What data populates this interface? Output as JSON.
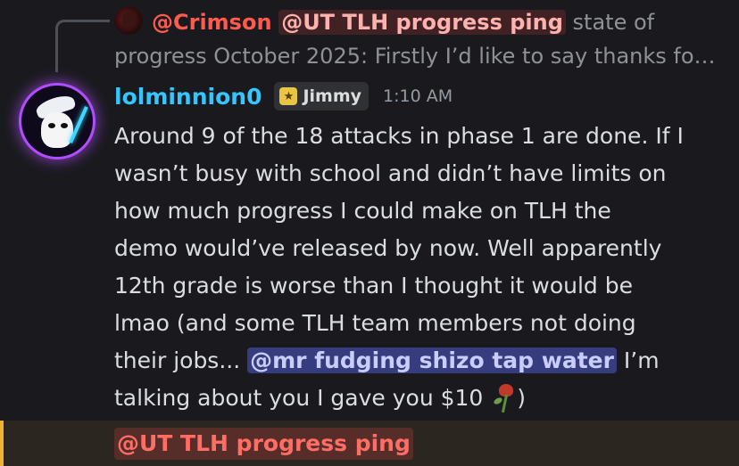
{
  "reply": {
    "author": "@Crimson",
    "mention": "@UT TLH progress ping",
    "excerpt_line1": "state of",
    "excerpt_line2": "progress October 2025:  Firstly I’d like to say thanks fo…"
  },
  "message": {
    "username": "lolminnion0",
    "tag": "Jimmy",
    "timestamp": "1:10 AM",
    "lines": [
      "Around 9 of the 18 attacks in phase 1 are done. If I",
      "wasn’t busy with school and didn’t have limits on",
      "how much progress I could make on TLH the",
      "demo would’ve released by now. Well apparently",
      "12th grade is worse than I thought it would be",
      "lmao (and some TLH team members not doing"
    ],
    "line7_before": "their jobs... ",
    "line7_mention": "@mr fudging shizo tap water",
    "line7_after": " I’m",
    "line8_before": "talking about you I gave you $10 ",
    "line8_after": ")"
  },
  "next_message": {
    "mention": "@UT TLH progress ping"
  },
  "colors": {
    "background": "#1a1a1e",
    "username": "#35c6ff",
    "mention_blue_bg": "#5865f2",
    "mention_red": "#ff5a4e",
    "highlight_bar": "#f0b232"
  },
  "icons": [
    "avatar-crimson",
    "avatar-lolminnion0",
    "jimmy-badge-icon",
    "wilted-rose-emoji"
  ]
}
